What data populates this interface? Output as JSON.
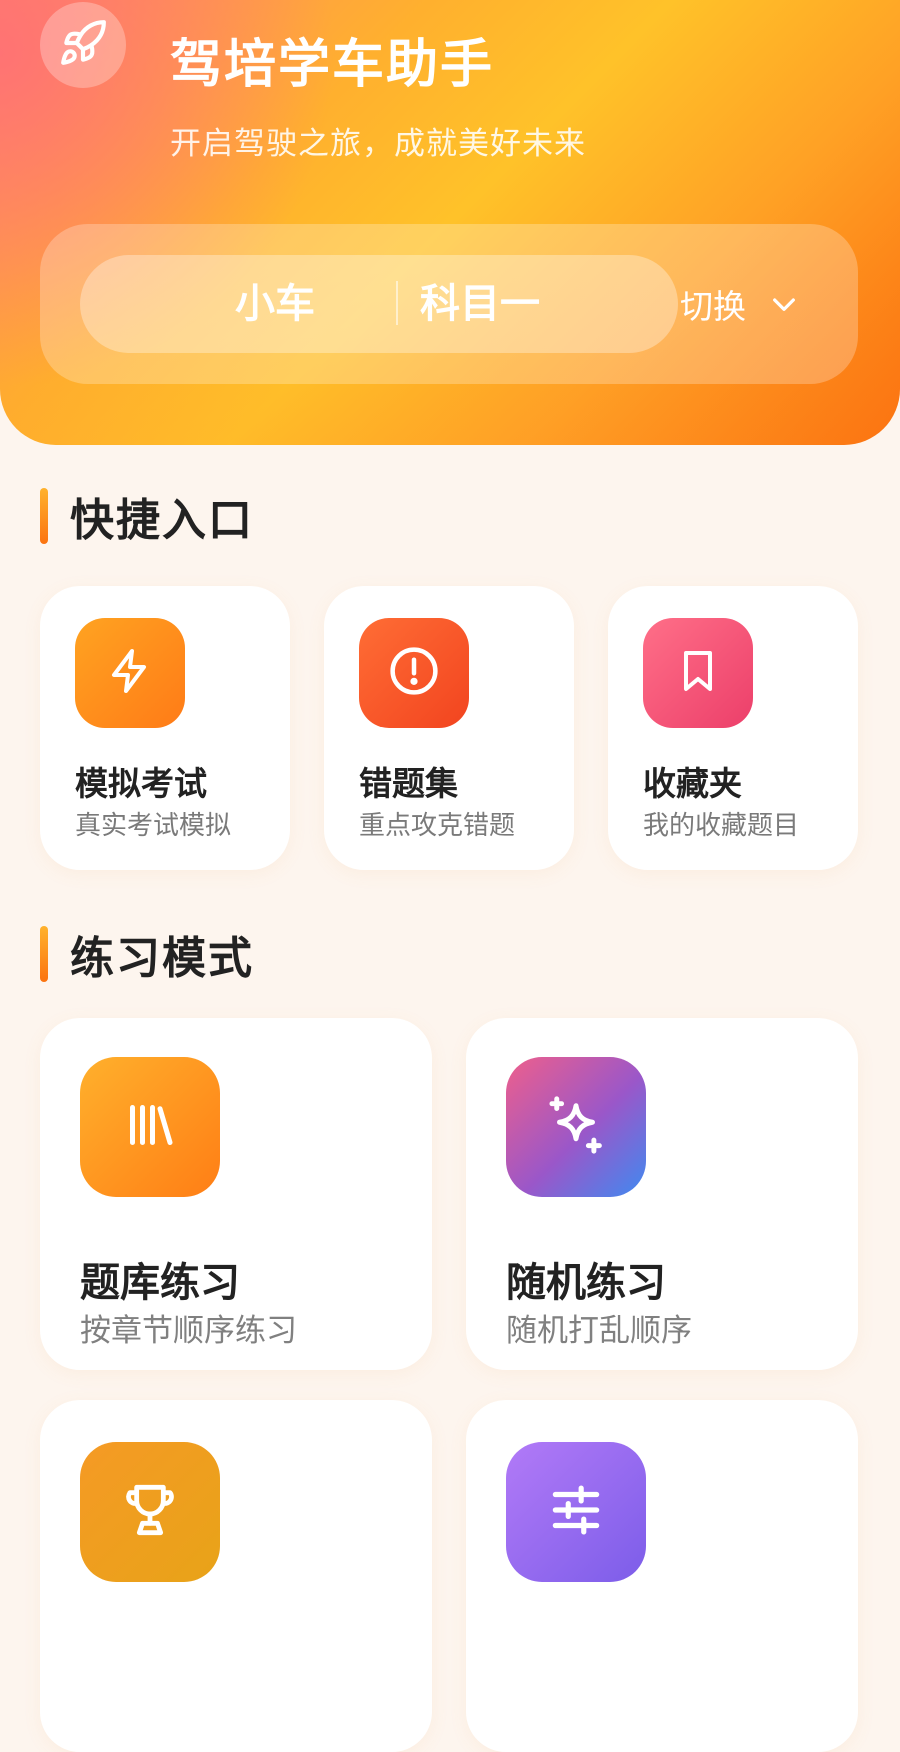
{
  "header": {
    "title": "驾培学车助手",
    "subtitle": "开启驾驶之旅，成就美好未来",
    "logo_icon": "rocket-icon",
    "selector": {
      "vehicle": "小车",
      "subject": "科目一",
      "switch_label": "切换",
      "switch_icon": "chevron-down-icon"
    }
  },
  "quick_entry": {
    "title": "快捷入口",
    "items": [
      {
        "title": "模拟考试",
        "subtitle": "真实考试模拟",
        "icon": "lightning-icon",
        "color": "#ff8a1c"
      },
      {
        "title": "错题集",
        "subtitle": "重点攻克错题",
        "icon": "alert-circle-icon",
        "color": "#f5542a"
      },
      {
        "title": "收藏夹",
        "subtitle": "我的收藏题目",
        "icon": "bookmark-icon",
        "color": "#f25278"
      }
    ]
  },
  "practice_mode": {
    "title": "练习模式",
    "items": [
      {
        "title": "题库练习",
        "subtitle": "按章节顺序练习",
        "icon": "library-icon",
        "color": "#ff8d1d"
      },
      {
        "title": "随机练习",
        "subtitle": "随机打乱顺序",
        "icon": "sparkles-icon",
        "color": "#9a57c9"
      },
      {
        "title": "",
        "subtitle": "",
        "icon": "trophy-icon",
        "color": "#f29f22"
      },
      {
        "title": "",
        "subtitle": "",
        "icon": "sliders-icon",
        "color": "#8f66ef"
      }
    ]
  },
  "colors": {
    "accent_orange": "#ff9a1f",
    "background": "#fdf5ee"
  }
}
